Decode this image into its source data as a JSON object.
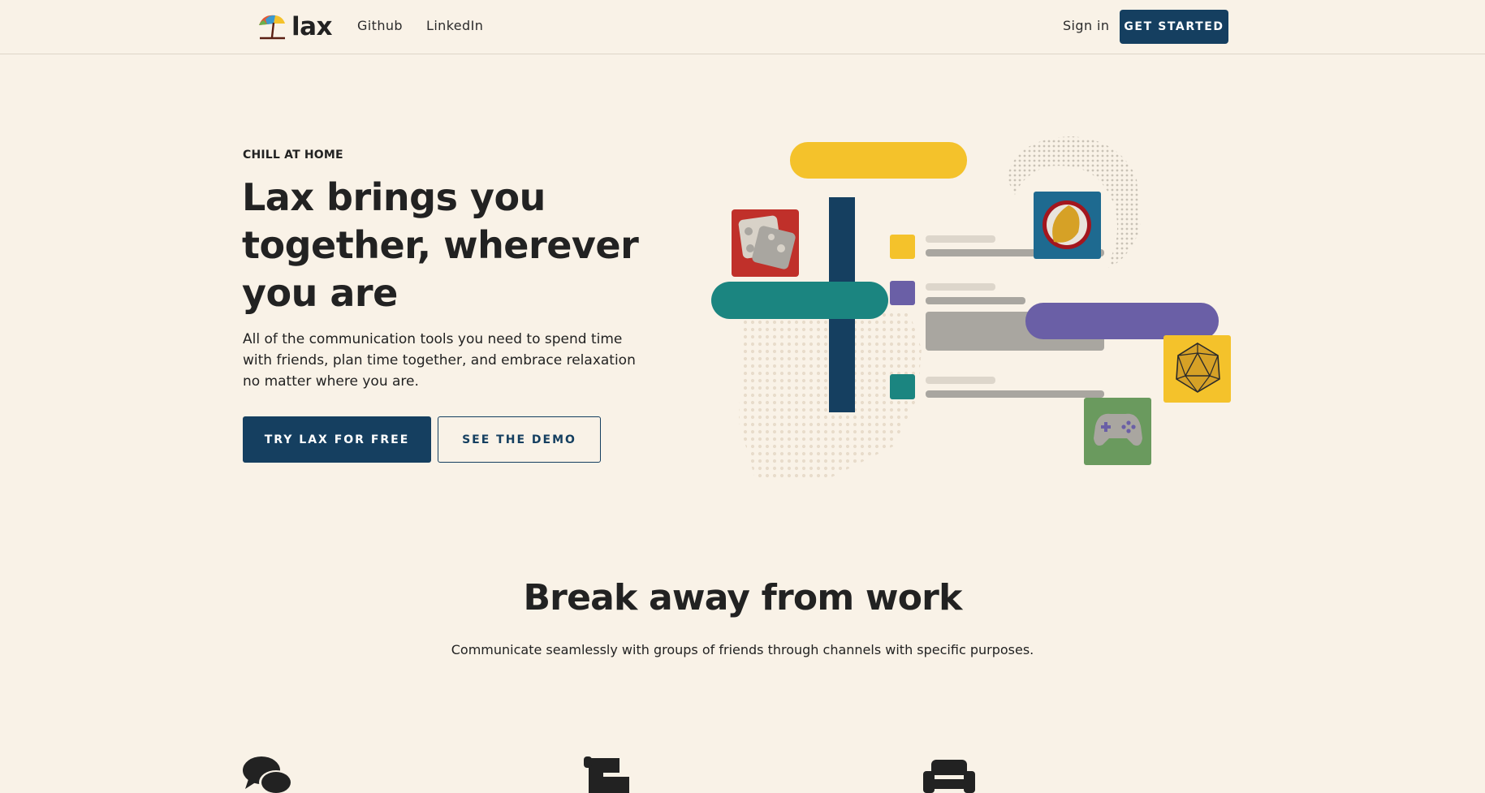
{
  "nav": {
    "logo_text": "lax",
    "links": [
      "Github",
      "LinkedIn"
    ],
    "sign_in": "Sign in",
    "cta": "GET STARTED"
  },
  "hero": {
    "eyebrow": "CHILL AT HOME",
    "headline": "Lax brings you together, wherever you are",
    "subtext": "All of the communication tools you need to spend time with friends, plan time together, and embrace relaxation no matter where you are.",
    "primary_button": "TRY LAX FOR FREE",
    "secondary_button": "SEE THE DEMO"
  },
  "section": {
    "title": "Break away from work",
    "subtitle": "Communicate seamlessly with groups of friends through channels with specific purposes."
  },
  "features": {
    "icons": [
      "chat-bubbles-icon",
      "scroll-icon",
      "couch-icon"
    ]
  },
  "colors": {
    "background": "#f9f2e7",
    "navy": "#153f60",
    "yellow": "#f4c22b",
    "teal": "#1b8580",
    "purple": "#6a5fa6",
    "red": "#c0302a",
    "blue_tile": "#1e6a90",
    "green_tile": "#6a9a5e"
  },
  "illustration_icons": [
    "dice-icon",
    "beach-ball-icon",
    "d20-icon",
    "gamepad-icon",
    "globe-dots-icon"
  ]
}
